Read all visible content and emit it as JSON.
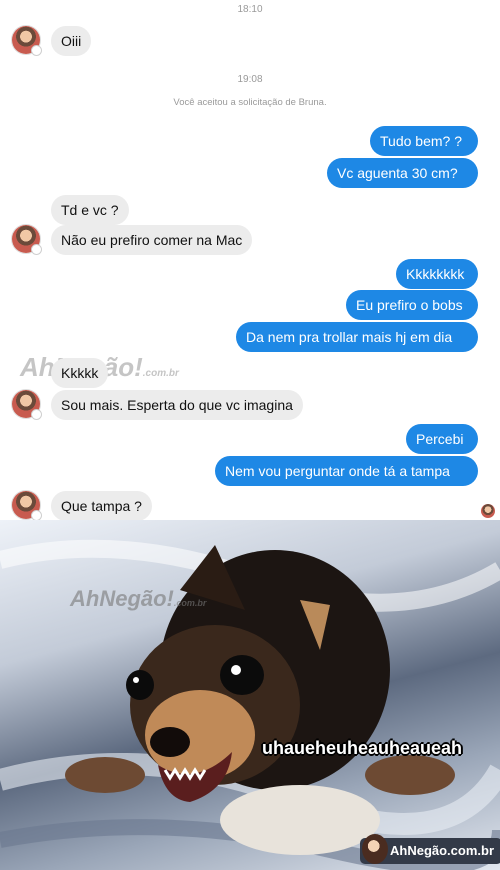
{
  "chat": {
    "timestamps": [
      "18:10",
      "19:08"
    ],
    "system_notice": "Você aceitou a solicitação de Bruna.",
    "messages": [
      {
        "side": "in",
        "text": "Oiii"
      },
      {
        "side": "out",
        "text": "Tudo bem? ?"
      },
      {
        "side": "out",
        "text": "Vc aguenta 30 cm?"
      },
      {
        "side": "in",
        "text": "Td e vc ?"
      },
      {
        "side": "in",
        "text": "Não eu prefiro comer na Mac"
      },
      {
        "side": "out",
        "text": "Kkkkkkkk"
      },
      {
        "side": "out",
        "text": "Eu prefiro o bobs"
      },
      {
        "side": "out",
        "text": "Da nem pra trollar mais hj em dia"
      },
      {
        "side": "in",
        "text": "Kkkkk"
      },
      {
        "side": "in",
        "text": "Sou  mais. Esperta do que vc imagina"
      },
      {
        "side": "out",
        "text": "Percebi"
      },
      {
        "side": "out",
        "text": "Nem vou perguntar onde tá a tampa"
      },
      {
        "side": "in",
        "text": "Que tampa ?"
      }
    ],
    "watermark": {
      "name": "AhNegão!",
      "domain": ".com.br"
    }
  },
  "meme": {
    "caption": "uhaueheuheauheaueah",
    "watermark": {
      "name": "AhNegão!",
      "domain": ".com.br"
    },
    "brand": "AhNegão.com.br"
  },
  "colors": {
    "outgoing_bubble": "#1e88e5",
    "incoming_bubble": "#ececec"
  }
}
